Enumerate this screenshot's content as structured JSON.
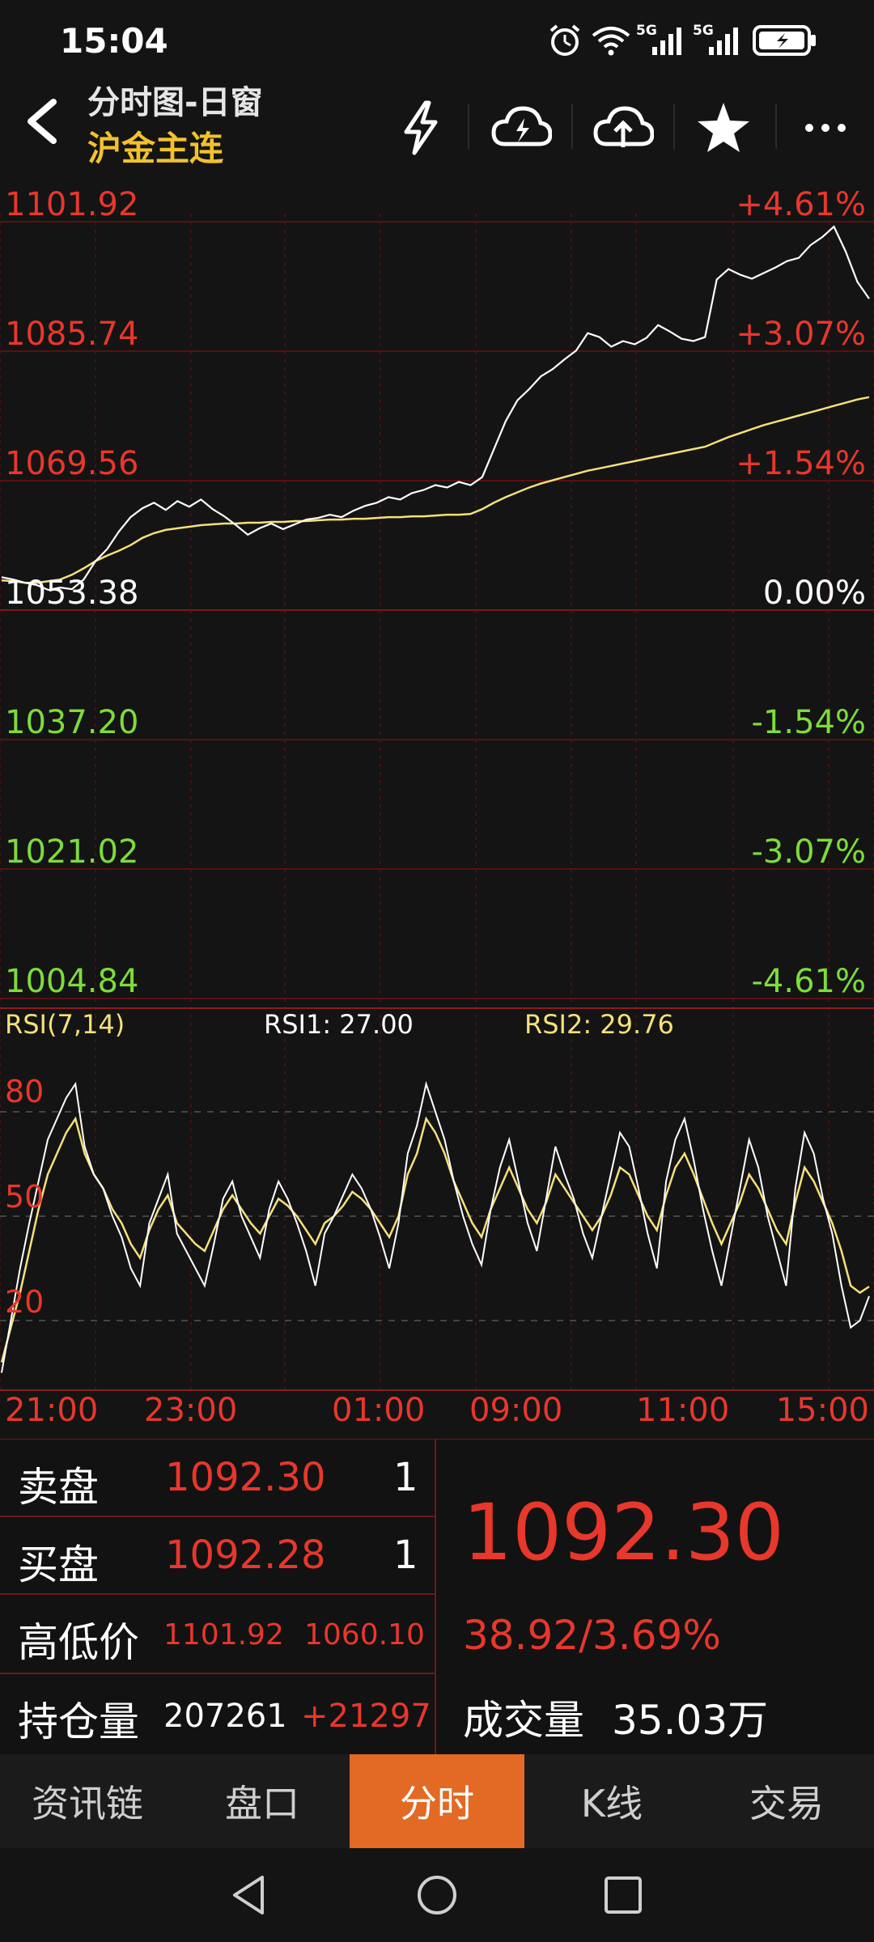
{
  "status_bar": {
    "time": "15:04",
    "signal_labels": [
      "5G",
      "5G"
    ]
  },
  "header": {
    "title": "分时图-日窗",
    "symbol": "沪金主连"
  },
  "chart": {
    "price_labels_left": [
      "1101.92",
      "1085.74",
      "1069.56",
      "1053.38",
      "1037.20",
      "1021.02",
      "1004.84"
    ],
    "percent_labels_right": [
      "+4.61%",
      "+3.07%",
      "+1.54%",
      "0.00%",
      "-1.54%",
      "-3.07%",
      "-4.61%"
    ],
    "rsi": {
      "title": "RSI(7,14)",
      "rsi1_label": "RSI1: 27.00",
      "rsi2_label": "RSI2: 29.76",
      "levels": [
        "80",
        "50",
        "20"
      ]
    },
    "time_labels": [
      "21:00",
      "23:00",
      "01:00",
      "09:00",
      "11:00",
      "15:00"
    ],
    "colors": {
      "up": "#e8372b",
      "down": "#7ddc3a",
      "price_line": "#ffffff",
      "avg_line": "#f5e07a",
      "grid": "#5a1010"
    }
  },
  "chart_data": {
    "type": "line",
    "title": "",
    "ylim": [
      1004.84,
      1101.92
    ],
    "series": [
      {
        "values": [
          1057.5,
          1057.2,
          1056.8,
          1056.5,
          1055.9,
          1056.2,
          1056.0,
          1057.2,
          1059.5,
          1061.0,
          1063.2,
          1065.0,
          1066.1,
          1066.8,
          1065.9,
          1067.0,
          1066.3,
          1067.2,
          1066.0,
          1065.1,
          1064.0,
          1062.8,
          1063.6,
          1064.2,
          1063.5,
          1064.1,
          1064.7,
          1064.9,
          1065.3,
          1065.0,
          1065.8,
          1066.4,
          1066.8,
          1067.5,
          1067.2,
          1068.0,
          1068.4,
          1069.0,
          1068.7,
          1069.4,
          1069.0,
          1070.0,
          1073.5,
          1077.0,
          1079.6,
          1081.0,
          1082.6,
          1083.5,
          1084.7,
          1085.8,
          1088.0,
          1087.5,
          1086.3,
          1087.0,
          1086.6,
          1087.4,
          1089.0,
          1088.2,
          1087.3,
          1087.0,
          1087.5,
          1094.7,
          1096.0,
          1095.3,
          1094.8,
          1095.5,
          1096.2,
          1097.0,
          1097.4,
          1099.0,
          1100.0,
          1101.3,
          1098.2,
          1094.4,
          1092.3
        ]
      },
      {
        "values": [
          1057.1,
          1057.0,
          1056.8,
          1056.8,
          1057.0,
          1057.2,
          1057.8,
          1058.6,
          1059.5,
          1060.2,
          1060.8,
          1061.5,
          1062.4,
          1063.0,
          1063.4,
          1063.6,
          1063.8,
          1064.0,
          1064.1,
          1064.2,
          1064.2,
          1064.3,
          1064.3,
          1064.4,
          1064.4,
          1064.5,
          1064.5,
          1064.6,
          1064.7,
          1064.7,
          1064.8,
          1064.8,
          1064.9,
          1065.0,
          1065.0,
          1065.1,
          1065.1,
          1065.2,
          1065.3,
          1065.3,
          1065.4,
          1066.0,
          1066.8,
          1067.5,
          1068.1,
          1068.7,
          1069.2,
          1069.6,
          1070.0,
          1070.4,
          1070.8,
          1071.1,
          1071.4,
          1071.7,
          1072.0,
          1072.3,
          1072.6,
          1072.9,
          1073.2,
          1073.5,
          1073.8,
          1074.4,
          1075.0,
          1075.5,
          1076.0,
          1076.5,
          1076.9,
          1077.3,
          1077.7,
          1078.1,
          1078.5,
          1078.9,
          1079.3,
          1079.7,
          1080.0
        ]
      }
    ],
    "rsi": {
      "ylim": [
        0,
        100
      ],
      "series": [
        {
          "name": "RSI1",
          "values": [
            5,
            20,
            35,
            48,
            60,
            72,
            78,
            84,
            88,
            70,
            62,
            58,
            50,
            44,
            35,
            30,
            48,
            55,
            62,
            45,
            40,
            35,
            30,
            42,
            55,
            60,
            50,
            44,
            38,
            52,
            60,
            55,
            48,
            40,
            30,
            45,
            50,
            56,
            62,
            58,
            52,
            44,
            35,
            48,
            68,
            76,
            88,
            80,
            72,
            60,
            50,
            42,
            36,
            52,
            64,
            72,
            60,
            48,
            40,
            55,
            70,
            62,
            55,
            45,
            38,
            50,
            62,
            74,
            70,
            58,
            45,
            35,
            60,
            72,
            78,
            66,
            52,
            40,
            30,
            44,
            58,
            72,
            64,
            50,
            40,
            30,
            58,
            74,
            68,
            55,
            45,
            30,
            18,
            20,
            27
          ]
        },
        {
          "name": "RSI2",
          "values": [
            8,
            18,
            28,
            40,
            52,
            62,
            68,
            74,
            78,
            68,
            62,
            58,
            52,
            48,
            42,
            38,
            46,
            52,
            56,
            48,
            45,
            42,
            40,
            46,
            52,
            56,
            52,
            48,
            45,
            50,
            55,
            53,
            50,
            46,
            42,
            48,
            50,
            53,
            57,
            55,
            52,
            48,
            44,
            50,
            62,
            68,
            78,
            74,
            68,
            60,
            54,
            48,
            44,
            52,
            58,
            64,
            58,
            52,
            48,
            54,
            62,
            58,
            54,
            50,
            46,
            50,
            56,
            64,
            62,
            56,
            50,
            46,
            56,
            64,
            68,
            62,
            55,
            48,
            42,
            48,
            54,
            62,
            58,
            52,
            46,
            42,
            54,
            64,
            60,
            54,
            48,
            40,
            30,
            28,
            29.76
          ]
        }
      ]
    }
  },
  "info_panel": {
    "sell_label": "卖盘",
    "sell_price": "1092.30",
    "sell_qty": "1",
    "buy_label": "买盘",
    "buy_price": "1092.28",
    "buy_qty": "1",
    "hilo_label": "高低价",
    "high": "1101.92",
    "low": "1060.10",
    "oi_label": "持仓量",
    "oi_value": "207261",
    "oi_change": "+21297",
    "last_price": "1092.30",
    "change": "38.92/3.69%",
    "volume_label": "成交量",
    "volume_value": "35.03万"
  },
  "tabs": [
    {
      "label": "资讯链",
      "active": false
    },
    {
      "label": "盘口",
      "active": false
    },
    {
      "label": "分时",
      "active": true
    },
    {
      "label": "K线",
      "active": false
    },
    {
      "label": "交易",
      "active": false
    }
  ]
}
